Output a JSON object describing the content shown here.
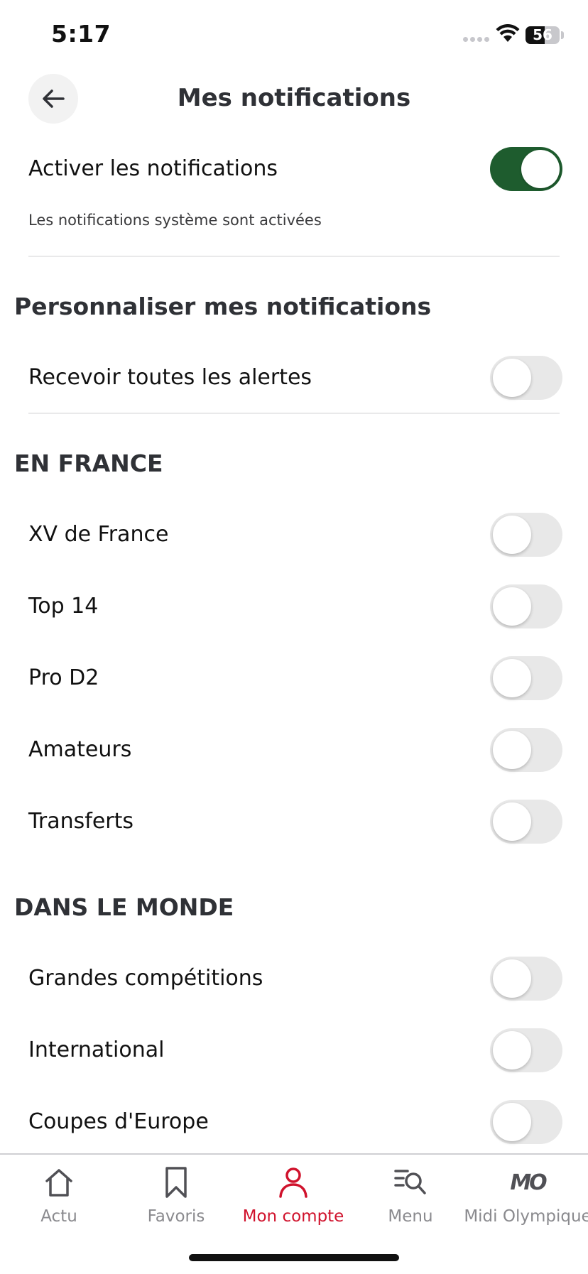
{
  "status_bar": {
    "time": "5:17",
    "battery": "56"
  },
  "header": {
    "title": "Mes notifications"
  },
  "master": {
    "label": "Activer les notifications",
    "subtext": "Les notifications système sont activées",
    "enabled": true
  },
  "personalize": {
    "title": "Personnaliser mes notifications",
    "all_alerts_label": "Recevoir toutes les alertes",
    "all_alerts_enabled": false
  },
  "france": {
    "title": "EN FRANCE",
    "items": [
      {
        "label": "XV de France",
        "enabled": false
      },
      {
        "label": "Top 14",
        "enabled": false
      },
      {
        "label": "Pro D2",
        "enabled": false
      },
      {
        "label": "Amateurs",
        "enabled": false
      },
      {
        "label": "Transferts",
        "enabled": false
      }
    ]
  },
  "world": {
    "title": "DANS LE MONDE",
    "items": [
      {
        "label": "Grandes compétitions",
        "enabled": false
      },
      {
        "label": "International",
        "enabled": false
      },
      {
        "label": "Coupes d'Europe",
        "enabled": false
      }
    ]
  },
  "tabbar": {
    "active_color": "#d0122c",
    "tabs": [
      {
        "label": "Actu",
        "icon": "home-icon",
        "active": false
      },
      {
        "label": "Favoris",
        "icon": "bookmark-icon",
        "active": false
      },
      {
        "label": "Mon compte",
        "icon": "user-icon",
        "active": true
      },
      {
        "label": "Menu",
        "icon": "menu-search-icon",
        "active": false
      },
      {
        "label": "Midi Olympique",
        "icon": "mo-logo-icon",
        "logo_text": "MO",
        "active": false
      }
    ]
  },
  "colors": {
    "toggle_on": "#1e5c2e",
    "toggle_off": "#e8e8e8"
  }
}
